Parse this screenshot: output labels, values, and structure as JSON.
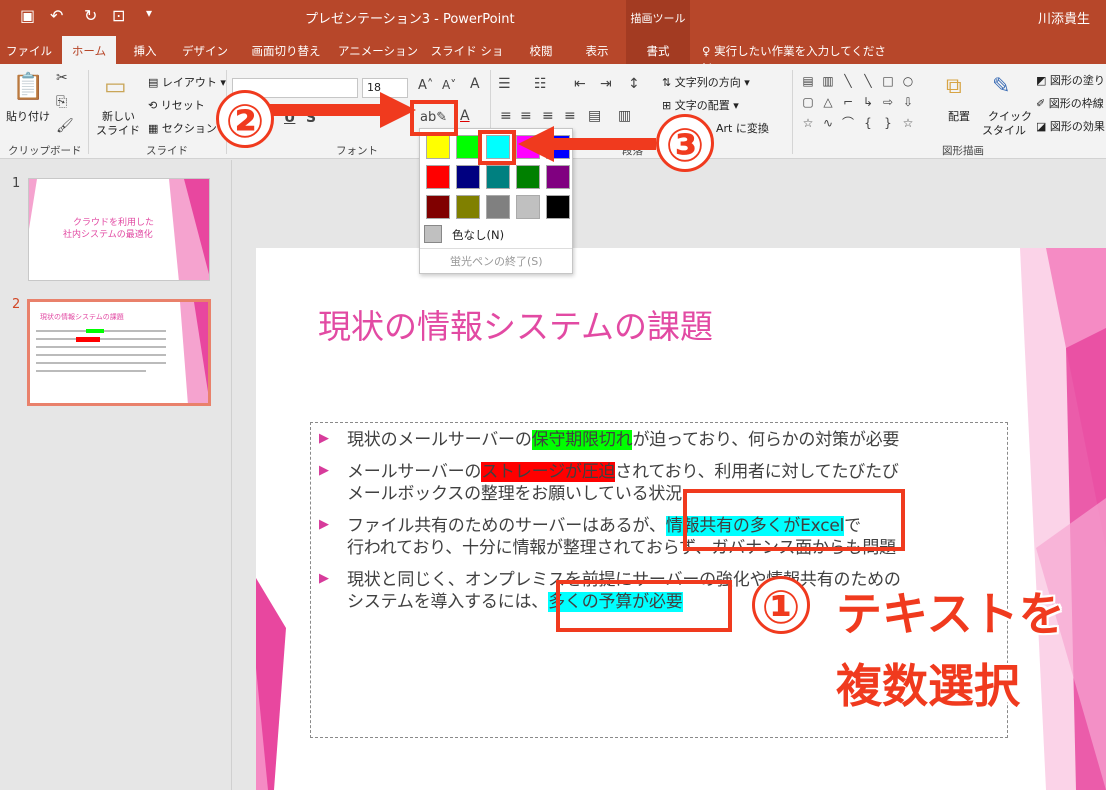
{
  "window": {
    "title": "プレゼンテーション3 - PowerPoint",
    "context_group": "描画ツール",
    "user": "川添貴生"
  },
  "tabs": [
    "ファイル",
    "ホーム",
    "挿入",
    "デザイン",
    "画面切り替え",
    "アニメーション",
    "スライド ショー",
    "校閲",
    "表示",
    "書式"
  ],
  "tell_me": "実行したい作業を入力してください",
  "ribbon": {
    "clipboard": {
      "paste": "貼り付け",
      "label": "クリップボード"
    },
    "slides": {
      "new_slide_1": "新しい",
      "new_slide_2": "スライド",
      "layout": "レイアウト",
      "reset": "リセット",
      "section": "セクション",
      "label": "スライド"
    },
    "font": {
      "size": "18",
      "label": "フォント"
    },
    "paragraph": {
      "label": "段落",
      "text_direction": "文字列の方向",
      "align_text": "文字の配置",
      "smartart": "Art に変換"
    },
    "drawing": {
      "label": "図形描画",
      "arrange": "配置",
      "quick_1": "クイック",
      "quick_2": "スタイル",
      "fill": "図形の塗り",
      "outline": "図形の枠線",
      "effects": "図形の効果"
    }
  },
  "highlight_menu": {
    "no_color": "色なし(N)",
    "stop": "蛍光ペンの終了(S)",
    "colors": [
      "#ffff00",
      "#00ff00",
      "#00ffff",
      "#ff00ff",
      "#0000ff",
      "#ff0000",
      "#000080",
      "#008080",
      "#008000",
      "#800080",
      "#800000",
      "#808000",
      "#808080",
      "#c0c0c0",
      "#000000"
    ]
  },
  "thumbnails": [
    {
      "num": "1",
      "title_1": "クラウドを利用した",
      "title_2": "社内システムの最適化"
    },
    {
      "num": "2",
      "title": "現状の情報システムの課題"
    }
  ],
  "slide": {
    "title": "現状の情報システムの課題",
    "bullets": [
      {
        "a": "現状のメールサーバーの",
        "hl": "保守期限切れ",
        "b": "が迫っており、何らかの対策が必要"
      },
      {
        "a": "メールサーバーの",
        "hl": "ストレージが圧迫",
        "b": "されており、利用者に対してたびたび",
        "l2": "メールボックスの整理をお願いしている状況"
      },
      {
        "a": "ファイル共有のためのサーバーはあるが、",
        "hl": "情報共有の多くがExcel",
        "b": "で",
        "l2": "行われており、十分に情報が整理されておらず、ガバナンス面からも問題"
      },
      {
        "a": "現状と同じく、オンプレミスを前提にサーバーの強化や情報共有のための",
        "l2a": "システムを導入するには、",
        "hl": "多くの予算が必要"
      }
    ]
  },
  "annotations": {
    "n1": "①",
    "n2": "②",
    "n3": "③",
    "label_1": "テキストを",
    "label_2": "複数選択"
  }
}
